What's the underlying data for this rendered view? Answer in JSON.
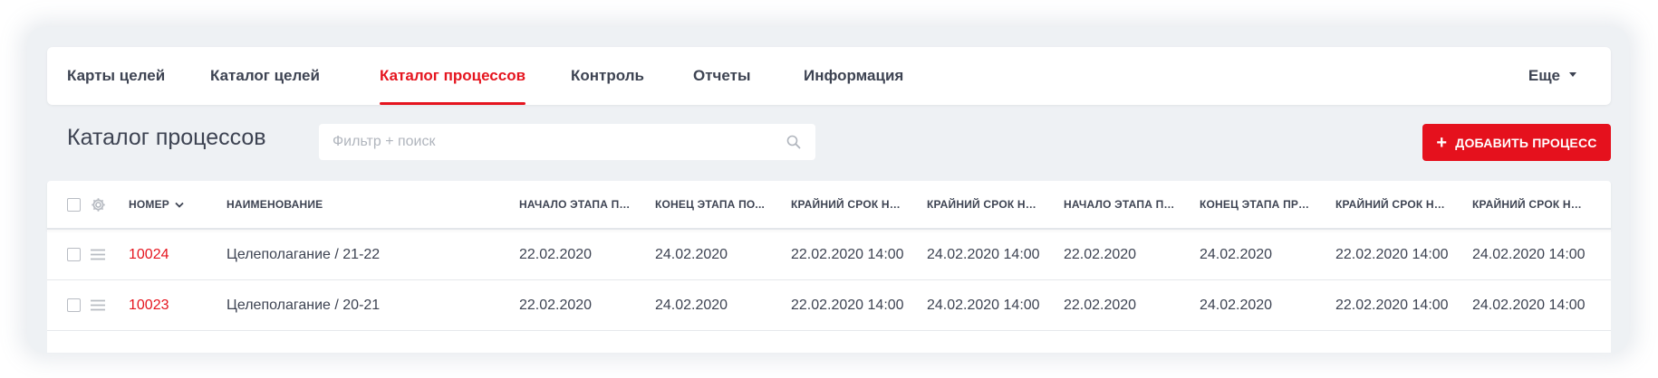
{
  "nav": {
    "tabs": [
      {
        "label": "Карты целей",
        "active": false
      },
      {
        "label": "Каталог целей",
        "active": false
      },
      {
        "label": "Каталог процессов",
        "active": true
      },
      {
        "label": "Контроль",
        "active": false
      },
      {
        "label": "Отчеты",
        "active": false
      },
      {
        "label": "Информация",
        "active": false
      }
    ],
    "more_label": "Еще"
  },
  "page": {
    "title": "Каталог процессов",
    "search_placeholder": "Фильтр + поиск",
    "add_button_label": "ДОБАВИТЬ ПРОЦЕСС"
  },
  "table": {
    "columns": [
      "НОМЕР",
      "НАИМЕНОВАНИЕ",
      "НАЧАЛО ЭТАПА ПОСТ...",
      "КОНЕЦ ЭТАПА ПО...",
      "КРАЙНИЙ СРОК НА С...",
      "КРАЙНИЙ СРОК НА С...",
      "НАЧАЛО ЭТАПА ПРОМ...",
      "КОНЕЦ ЭТАПА ПРОМЕ...",
      "КРАЙНИЙ СРОК НА С...",
      "КРАЙНИЙ СРОК НА С..."
    ],
    "rows": [
      {
        "number": "10024",
        "name": "Целеполагание / 21-22",
        "cells": [
          "22.02.2020",
          "24.02.2020",
          "22.02.2020 14:00",
          "24.02.2020 14:00",
          "22.02.2020",
          "24.02.2020",
          "22.02.2020 14:00",
          "24.02.2020 14:00"
        ]
      },
      {
        "number": "10023",
        "name": "Целеполагание / 20-21",
        "cells": [
          "22.02.2020",
          "24.02.2020",
          "22.02.2020 14:00",
          "24.02.2020 14:00",
          "22.02.2020",
          "24.02.2020",
          "22.02.2020 14:00",
          "24.02.2020 14:00"
        ]
      }
    ]
  },
  "colors": {
    "accent": "#e5151f",
    "text": "#3d4352",
    "background": "#eef1f4"
  }
}
